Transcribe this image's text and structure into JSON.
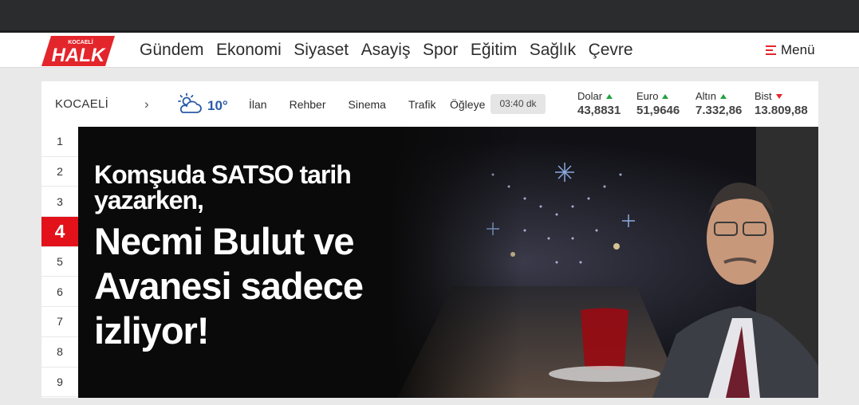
{
  "site": {
    "logo_small": "KOCAELİ",
    "logo_main": "HALK",
    "brand_color": "#e3262c"
  },
  "nav": {
    "items": [
      {
        "label": "Gündem"
      },
      {
        "label": "Ekonomi"
      },
      {
        "label": "Siyaset"
      },
      {
        "label": "Asayiş"
      },
      {
        "label": "Spor"
      },
      {
        "label": "Eğitim"
      },
      {
        "label": "Sağlık"
      },
      {
        "label": "Çevre"
      }
    ],
    "menu_label": "Menü"
  },
  "info": {
    "city": "KOCAELİ",
    "city_arrow": "›",
    "weather_icon": "partly-cloudy-icon",
    "temperature": "10°",
    "links": [
      {
        "label": "İlan"
      },
      {
        "label": "Rehber"
      },
      {
        "label": "Sinema"
      },
      {
        "label": "Trafik"
      }
    ],
    "prayer_label": "Öğleye",
    "prayer_time": "03:40 dk"
  },
  "currencies": [
    {
      "name": "Dolar",
      "value": "43,8831",
      "trend": "up"
    },
    {
      "name": "Euro",
      "value": "51,9646",
      "trend": "up"
    },
    {
      "name": "Altın",
      "value": "7.332,86",
      "trend": "up"
    },
    {
      "name": "Bist",
      "value": "13.809,88",
      "trend": "down"
    }
  ],
  "slider": {
    "numbers": [
      "1",
      "2",
      "3",
      "4",
      "5",
      "6",
      "7",
      "8",
      "9"
    ],
    "active_index": 3
  },
  "headline": {
    "top": "Komşuda SATSO tarih yazarken,",
    "main": "Necmi Bulut ve Avanesi sadece izliyor!"
  }
}
